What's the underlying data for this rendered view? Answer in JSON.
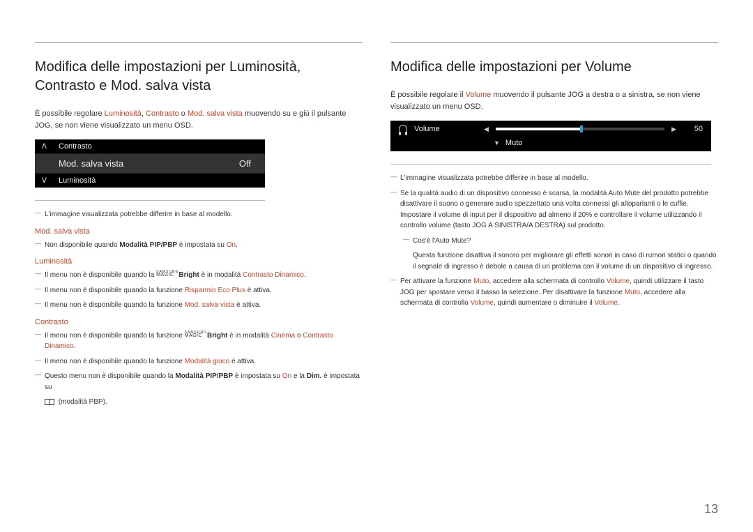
{
  "pageNumber": "13",
  "left": {
    "heading": "Modifica delle impostazioni per Luminosità, Contrasto e Mod. salva vista",
    "intro_1": "È possibile regolare ",
    "intro_hl1": "Luminosità",
    "intro_sep1": ", ",
    "intro_hl2": "Contrasto",
    "intro_sep2": " o ",
    "intro_hl3": "Mod. salva vista",
    "intro_2": " muovendo su e giù il pulsante JOG, se non viene visualizzato un menu OSD.",
    "osd": {
      "up": "Contrasto",
      "sel": "Mod. salva vista",
      "sel_val": "Off",
      "down": "Luminosità"
    },
    "note_img": "L'immagine visualizzata potrebbe differire in base al modello.",
    "sect1_label": "Mod. salva vista",
    "sect1_note_a": "Non disponibile quando ",
    "sect1_note_b": "Modalità PIP/PBP",
    "sect1_note_c": " è impostata su ",
    "sect1_note_d": "On",
    "sect1_note_e": ".",
    "sect2_label": "Luminosità",
    "sect2_n1_a": "Il menu non è disponibile quando la ",
    "sect2_n1_b": "Bright",
    "sect2_n1_c": " è in modalità ",
    "sect2_n1_d": "Contrasto Dinamico",
    "sect2_n1_e": ".",
    "sect2_n2_a": "Il menu non è disponibile quando la funzione ",
    "sect2_n2_b": "Risparmio Eco Plus",
    "sect2_n2_c": " è attiva.",
    "sect2_n3_a": "Il menu non è disponibile quando la funzione ",
    "sect2_n3_b": "Mod. salva vista",
    "sect2_n3_c": " è attiva.",
    "sect3_label": "Contrasto",
    "sect3_n1_a": "Il menu non è disponibile quando la funzione ",
    "sect3_n1_b": "Bright",
    "sect3_n1_c": " è in modalità ",
    "sect3_n1_d": "Cinema",
    "sect3_n1_e": " o ",
    "sect3_n1_f": "Contrasto Dinamico",
    "sect3_n1_g": ".",
    "sect3_n2_a": "Il menu non è disponibile quando la funzione ",
    "sect3_n2_b": "Modalità gioco",
    "sect3_n2_c": " è attiva.",
    "sect3_n3_a": "Questo menu non è disponibile quando la ",
    "sect3_n3_b": "Modalità PIP/PBP",
    "sect3_n3_c": " è impostata su ",
    "sect3_n3_d": "On",
    "sect3_n3_e": " e la ",
    "sect3_n3_f": "Dim.",
    "sect3_n3_g": " è impostata su",
    "sect3_n3_tail": " (modalità PBP).",
    "magic_top": "SAMSUNG",
    "magic_bot": "MAGIC"
  },
  "right": {
    "heading": "Modifica delle impostazioni per Volume",
    "intro_1": "È possibile regolare il ",
    "intro_hl": "Volume",
    "intro_2": " muovendo il pulsante JOG a destra o a sinistra, se non viene visualizzato un menu OSD.",
    "osd": {
      "vol_label": "Volume",
      "vol_value": "50",
      "muto": "Muto"
    },
    "note_img": "L'immagine visualizzata potrebbe differire in base al modello.",
    "note_auto_a": "Se la qualità audio di un dispositivo connesso è scarsa, la modalità Auto Mute del prodotto potrebbe disattivare il suono o generare audio spezzettato una volta connessi gli altoparlanti o le cuffie. Impostare il volume di input per il dispositivo ad almeno il 20% e controllare il volume utilizzando il controllo volume (tasto JOG A SINISTRA/A DESTRA) sul prodotto.",
    "sub_q": "Cos'è l'Auto Mute?",
    "sub_a": "Questa funzione disattiva il sonoro per migliorare gli effetti sonori in caso di rumori statici o quando il segnale di ingresso è debole a causa di un problema con il volume di un dispositivo di ingresso.",
    "note_muto_a": "Per attivare la funzione ",
    "note_muto_b": "Muto",
    "note_muto_c": ", accedere alla schermata di controllo ",
    "note_muto_d": "Volume",
    "note_muto_e": ", quindi utilizzare il tasto JOG per spostare verso il basso la selezione. Per disattivare la funzione ",
    "note_muto_f": "Muto",
    "note_muto_g": ", accedere alla schermata di controllo ",
    "note_muto_h": "Volume",
    "note_muto_i": ", quindi aumentare o diminuire il ",
    "note_muto_j": "Volume",
    "note_muto_k": "."
  }
}
